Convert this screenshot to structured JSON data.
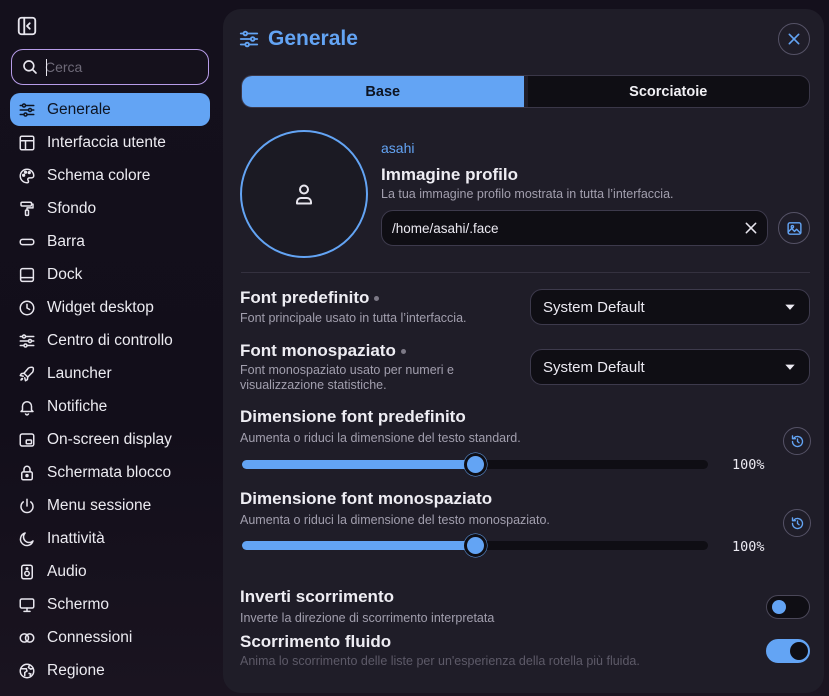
{
  "sidebar": {
    "search_placeholder": "Cerca",
    "items": [
      {
        "label": "Generale",
        "icon": "sliders-icon",
        "active": true
      },
      {
        "label": "Interfaccia utente",
        "icon": "layout-icon"
      },
      {
        "label": "Schema colore",
        "icon": "palette-icon"
      },
      {
        "label": "Sfondo",
        "icon": "paint-roller-icon"
      },
      {
        "label": "Barra",
        "icon": "bar-icon"
      },
      {
        "label": "Dock",
        "icon": "dock-icon"
      },
      {
        "label": "Widget desktop",
        "icon": "clock-icon"
      },
      {
        "label": "Centro di controllo",
        "icon": "sliders-icon"
      },
      {
        "label": "Launcher",
        "icon": "rocket-icon"
      },
      {
        "label": "Notifiche",
        "icon": "bell-icon"
      },
      {
        "label": "On-screen display",
        "icon": "osd-icon"
      },
      {
        "label": "Schermata blocco",
        "icon": "lock-icon"
      },
      {
        "label": "Menu sessione",
        "icon": "power-icon"
      },
      {
        "label": "Inattività",
        "icon": "moon-icon"
      },
      {
        "label": "Audio",
        "icon": "speaker-icon"
      },
      {
        "label": "Schermo",
        "icon": "monitor-icon"
      },
      {
        "label": "Connessioni",
        "icon": "link-icon"
      },
      {
        "label": "Regione",
        "icon": "globe-icon"
      }
    ]
  },
  "panel": {
    "title": "Generale",
    "tabs": [
      {
        "label": "Base",
        "active": true
      },
      {
        "label": "Scorciatoie",
        "active": false
      }
    ],
    "profile": {
      "username": "asahi",
      "title": "Immagine profilo",
      "description": "La tua immagine profilo mostrata in tutta l’interfaccia.",
      "path": "/home/asahi/.face"
    },
    "font_default": {
      "title": "Font predefinito",
      "description": "Font principale usato in tutta l’interfaccia.",
      "value": "System Default"
    },
    "font_mono": {
      "title": "Font monospaziato",
      "description_1": "Font monospaziato usato per numeri e",
      "description_2": "visualizzazione statistiche.",
      "value": "System Default"
    },
    "font_size_default": {
      "title": "Dimensione font predefinito",
      "description": "Aumenta o riduci la dimensione del testo standard.",
      "value_label": "100%",
      "level": 0.5
    },
    "font_size_mono": {
      "title": "Dimensione font monospaziato",
      "description": "Aumenta o riduci la dimensione del testo monospaziato.",
      "value_label": "100%",
      "level": 0.5
    },
    "invert_scroll": {
      "title": "Inverti scorrimento",
      "description": "Inverte la direzione di scorrimento interpretata",
      "enabled": false
    },
    "smooth_scroll": {
      "title": "Scorrimento fluido",
      "description": "Anima lo scorrimento delle liste per un'esperienza della rotella più fluida.",
      "enabled": true
    }
  },
  "colors": {
    "accent": "#63a4f4",
    "panel_bg": "#1f1d28",
    "search_border": "#b79ce8"
  }
}
